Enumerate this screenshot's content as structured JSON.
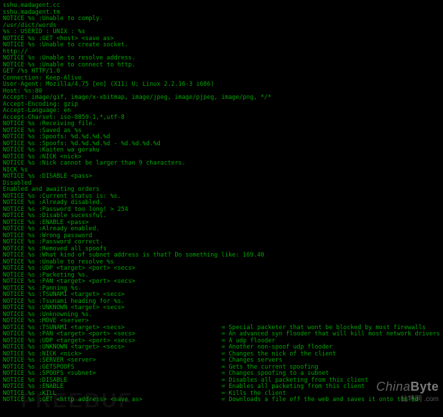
{
  "lines": [
    {
      "t": "sshu.madagent.cc"
    },
    {
      "t": "sshu.madagent.tm"
    },
    {
      "t": "NOTICE %s :Unable to comply."
    },
    {
      "t": "/usr/dict/words"
    },
    {
      "t": "%s : USERID : UNIX : %s"
    },
    {
      "t": "NOTICE %s :GET <host> <save as>"
    },
    {
      "t": "NOTICE %s :Unable to create socket."
    },
    {
      "t": "http://"
    },
    {
      "t": "NOTICE %s :Unable to resolve address."
    },
    {
      "t": "NOTICE %s :Unable to connect to http."
    },
    {
      "t": "GET /%s HTTP/1.0"
    },
    {
      "t": "Connection: Keep-Alive"
    },
    {
      "t": "User-Agent: Mozilla/4.75 [en] (X11; U; Linux 2.2.16-3 i686)"
    },
    {
      "t": "Host: %s:80"
    },
    {
      "t": "Accept: image/gif, image/x-xbitmap, image/jpeg, image/pjpeg, image/png, */*"
    },
    {
      "t": "Accept-Encoding: gzip"
    },
    {
      "t": "Accept-Language: en"
    },
    {
      "t": "Accept-Charset: iso-8859-1,*,utf-8"
    },
    {
      "t": "NOTICE %s :Receiving file."
    },
    {
      "t": "NOTICE %s :Saved as %s"
    },
    {
      "t": "NOTICE %s :Spoofs: %d.%d.%d.%d"
    },
    {
      "t": "NOTICE %s :Spoofs: %d.%d.%d.%d - %d.%d.%d.%d"
    },
    {
      "t": "NOTICE %s :Kaiten wa goraku"
    },
    {
      "t": "NOTICE %s :NICK <nick>"
    },
    {
      "t": "NOTICE %s :Nick cannot be larger than 9 characters."
    },
    {
      "t": "NICK %s"
    },
    {
      "t": "NOTICE %s :DISABLE <pass>"
    },
    {
      "t": "Disabled"
    },
    {
      "t": "Enabled and awaiting orders"
    },
    {
      "t": "NOTICE %s :Current status is: %s."
    },
    {
      "t": "NOTICE %s :Already disabled."
    },
    {
      "t": "NOTICE %s :Password too long! > 254"
    },
    {
      "t": "NOTICE %s :Disable sucessful."
    },
    {
      "t": "NOTICE %s :ENABLE <pass>"
    },
    {
      "t": "NOTICE %s :Already enabled."
    },
    {
      "t": "NOTICE %s :Wrong password"
    },
    {
      "t": "NOTICE %s :Password correct."
    },
    {
      "t": "NOTICE %s :Removed all spoofs"
    },
    {
      "t": "NOTICE %s :What kind of subnet address is that? Do something like: 169.40"
    },
    {
      "t": "NOTICE %s :Unable to resolve %s"
    },
    {
      "t": "NOTICE %s :UDP <target> <port> <secs>"
    },
    {
      "t": "NOTICE %s :Packeting %s."
    },
    {
      "t": "NOTICE %s :PAN <target> <port> <secs>"
    },
    {
      "t": "NOTICE %s :Panning %s."
    },
    {
      "t": "NOTICE %s :TSUNAMI <target> <secs>"
    },
    {
      "t": "NOTICE %s :Tsunami heading for %s."
    },
    {
      "t": "NOTICE %s :UNKNOWN <target> <secs>"
    },
    {
      "t": "NOTICE %s :Unknowning %s."
    },
    {
      "t": "NOTICE %s :MOVE <server>"
    },
    {
      "l": "NOTICE %s :TSUNAMI <target> <secs>",
      "r": "= Special packeter that wont be blocked by most firewalls"
    },
    {
      "l": "NOTICE %s :PAN <target> <port> <secs>",
      "r": "= An advanced syn flooder that will kill most network drivers"
    },
    {
      "l": "NOTICE %s :UDP <target> <port> <secs>",
      "r": "= A udp flooder"
    },
    {
      "l": "NOTICE %s :UNKNOWN <target> <secs>",
      "r": "= Another non-spoof udp flooder"
    },
    {
      "l": "NOTICE %s :NICK <nick>",
      "r": "= Changes the nick of the client"
    },
    {
      "l": "NOTICE %s :SERVER <server>",
      "r": "= Changes servers"
    },
    {
      "l": "NOTICE %s :GETSPOOFS",
      "r": "= Gets the current spoofing"
    },
    {
      "l": "NOTICE %s :SPOOFS <subnet>",
      "r": "= Changes spoofing to a subnet"
    },
    {
      "l": "NOTICE %s :DISABLE",
      "r": "= Disables all packeting from this client"
    },
    {
      "l": "NOTICE %s :ENABLE",
      "r": "= Enables all packeting from this client"
    },
    {
      "l": "NOTICE %s :KILL",
      "r": "= Kills the client"
    },
    {
      "l": "NOTICE %s :GET <http address> <save as>",
      "r": "= Downloads a file off the web and saves it onto the hd"
    }
  ],
  "watermark": {
    "main": "ChinaByte",
    "sub": "比特网         .com",
    "fb": "FREEBUF"
  }
}
